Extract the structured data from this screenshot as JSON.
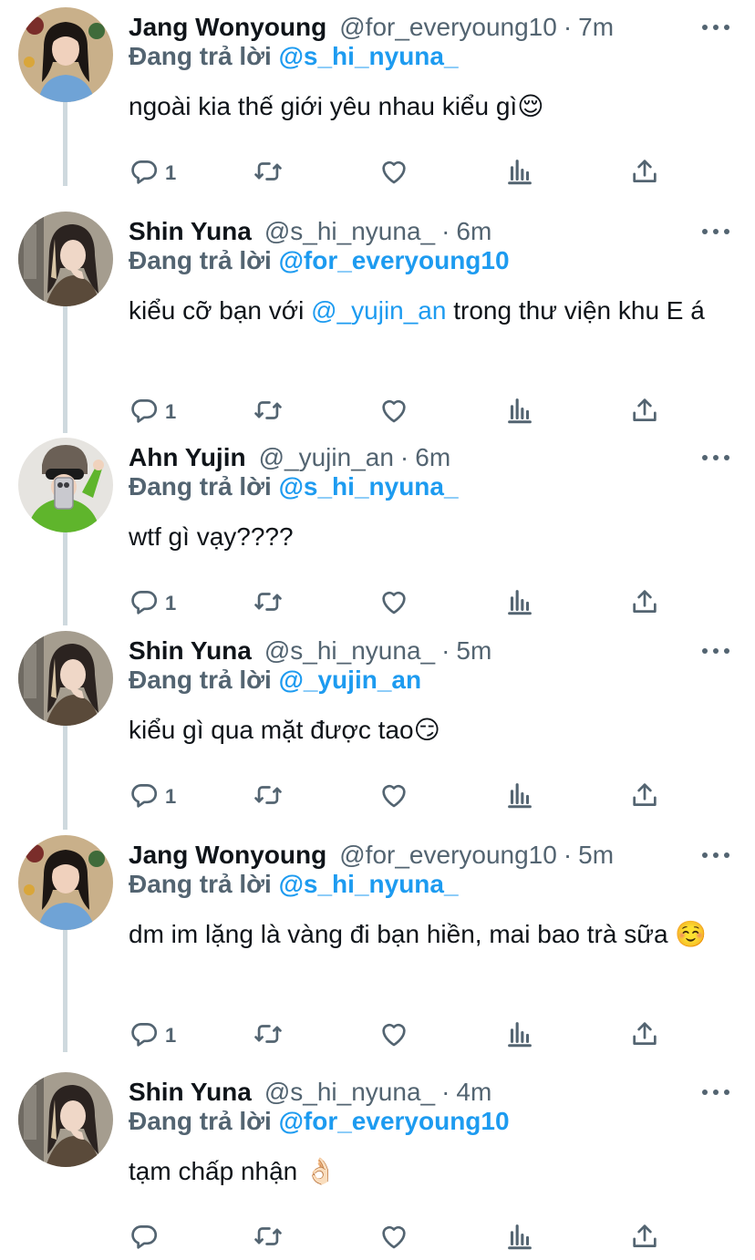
{
  "tweets": [
    {
      "name": "Jang Wonyoung",
      "handle": "@for_everyoung10",
      "time": "7m",
      "replying_prefix": "Đang trả lời",
      "replying_to": "@s_hi_nyuna_",
      "text_before": "ngoài kia thế giới yêu nhau kiểu gì😌",
      "mention": "",
      "text_after": "",
      "reply_count": "1",
      "avatar": "avatar-wonyoung"
    },
    {
      "name": "Shin Yuna",
      "handle": "@s_hi_nyuna_",
      "time": "6m",
      "replying_prefix": "Đang trả lời",
      "replying_to": "@for_everyoung10",
      "text_before": "kiểu cỡ bạn với ",
      "mention": "@_yujin_an",
      "text_after": " trong thư viện khu E á",
      "reply_count": "1",
      "avatar": "avatar-yuna"
    },
    {
      "name": "Ahn Yujin",
      "handle": "@_yujin_an",
      "time": "6m",
      "replying_prefix": "Đang trả lời",
      "replying_to": "@s_hi_nyuna_",
      "text_before": "wtf gì vạy????",
      "mention": "",
      "text_after": "",
      "reply_count": "1",
      "avatar": "avatar-yujin"
    },
    {
      "name": "Shin Yuna",
      "handle": "@s_hi_nyuna_",
      "time": "5m",
      "replying_prefix": "Đang trả lời",
      "replying_to": "@_yujin_an",
      "text_before": "kiểu gì qua mặt được tao😏",
      "mention": "",
      "text_after": "",
      "reply_count": "1",
      "avatar": "avatar-yuna"
    },
    {
      "name": "Jang Wonyoung",
      "handle": "@for_everyoung10",
      "time": "5m",
      "replying_prefix": "Đang trả lời",
      "replying_to": "@s_hi_nyuna_",
      "text_before": "dm im lặng là vàng đi bạn hiền, mai bao trà sữa ☺️",
      "mention": "",
      "text_after": "",
      "reply_count": "1",
      "avatar": "avatar-wonyoung"
    },
    {
      "name": "Shin Yuna",
      "handle": "@s_hi_nyuna_",
      "time": "4m",
      "replying_prefix": "Đang trả lời",
      "replying_to": "@for_everyoung10",
      "text_before": "tạm chấp nhận 👌🏻",
      "mention": "",
      "text_after": "",
      "reply_count": "",
      "avatar": "avatar-yuna"
    }
  ],
  "colors": {
    "accent": "#1d9bf0",
    "muted": "#536471",
    "thread_line": "#cfd9de"
  },
  "icons": [
    "reply-icon",
    "retweet-icon",
    "like-icon",
    "analytics-icon",
    "share-icon",
    "more-icon"
  ]
}
